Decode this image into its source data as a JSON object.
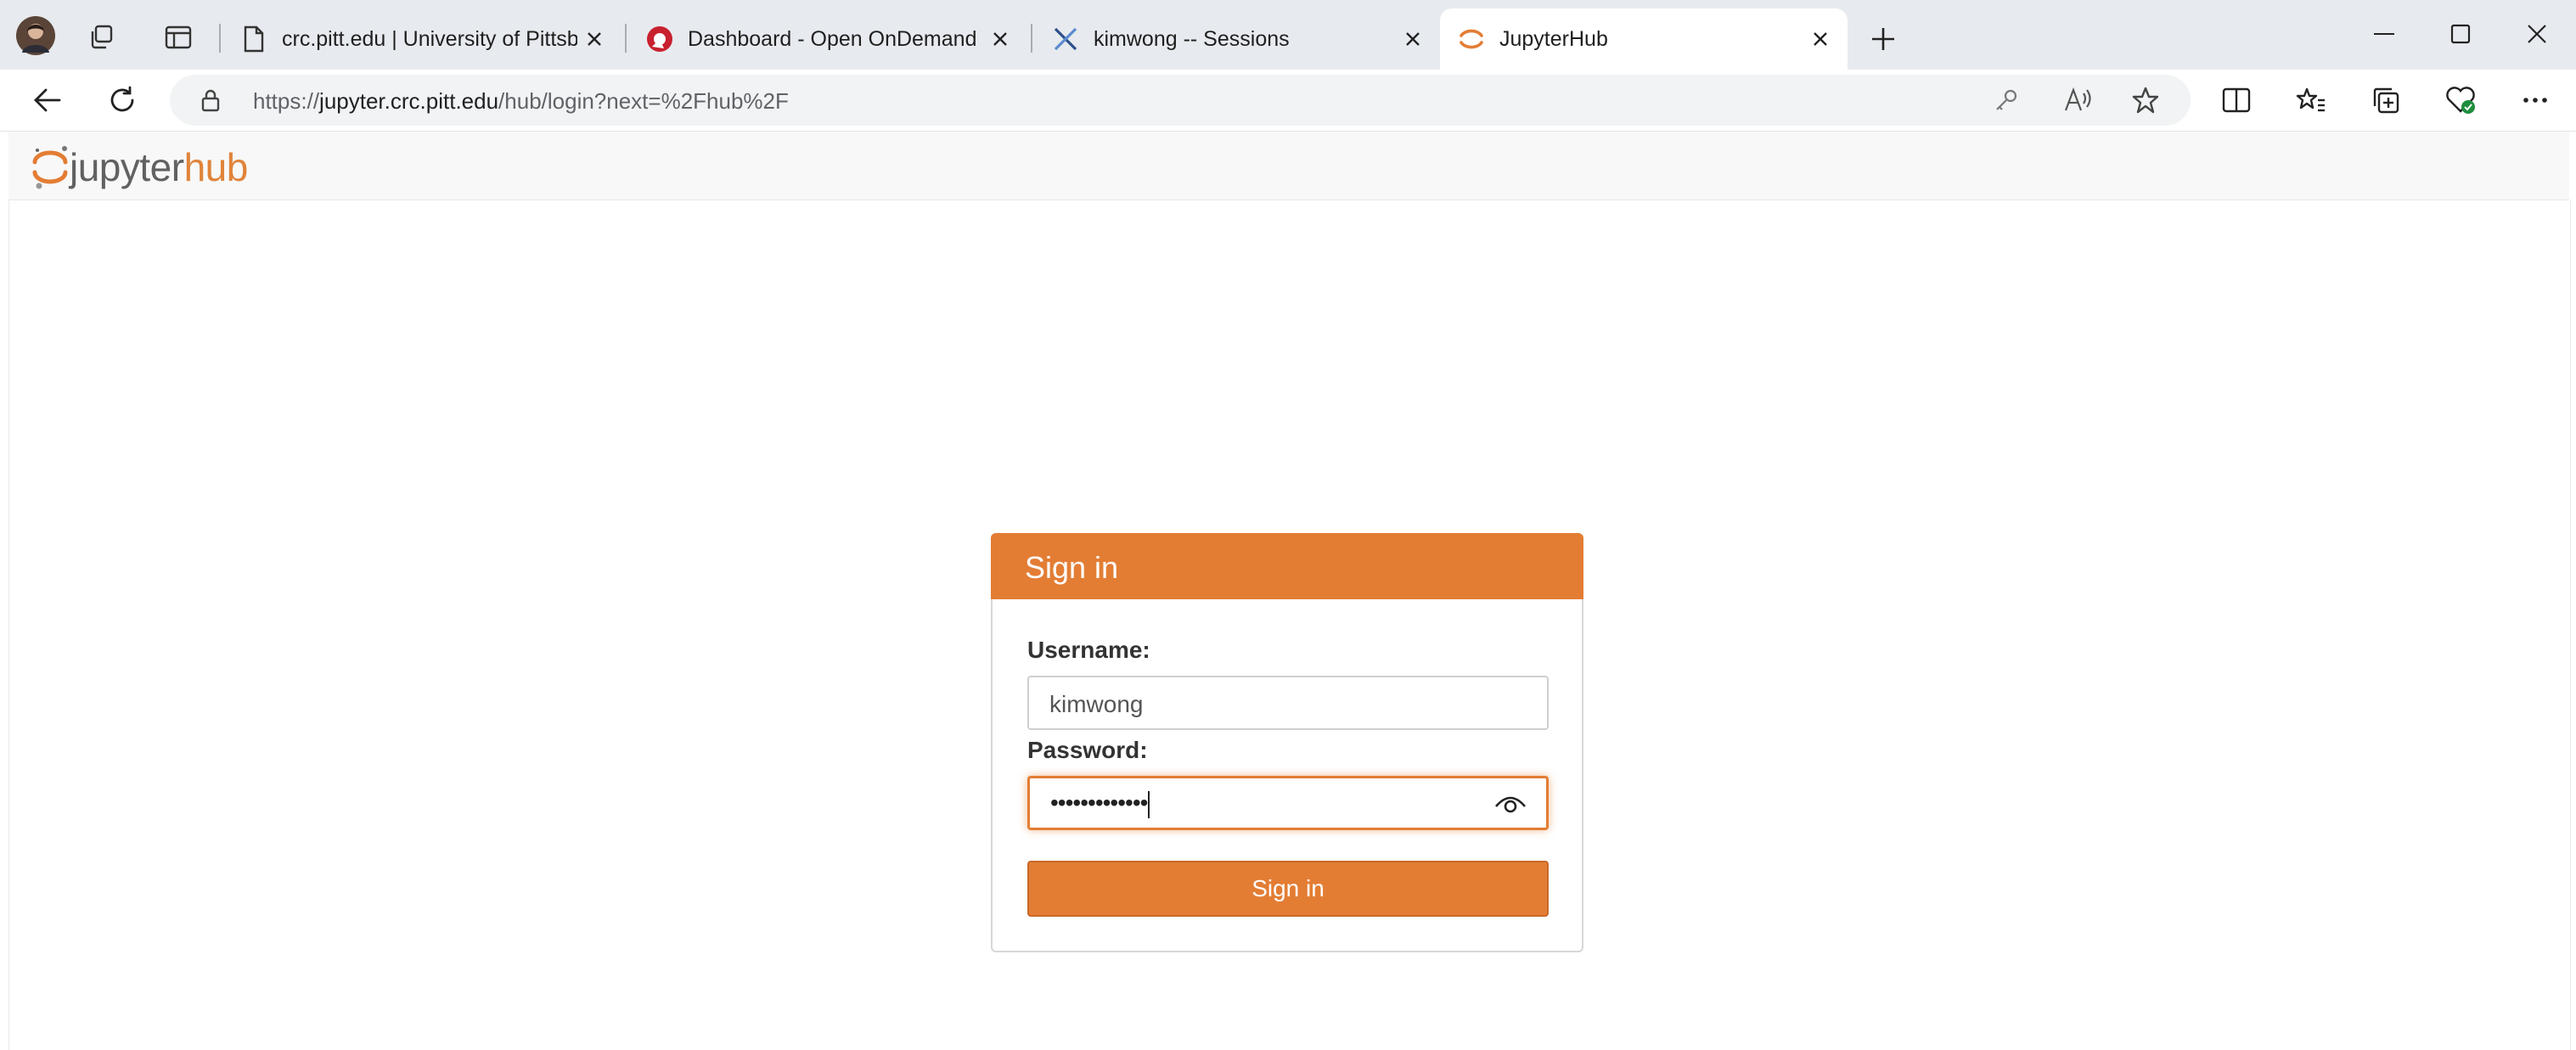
{
  "browser": {
    "tabs": [
      {
        "title": "crc.pitt.edu | University of Pittsbur",
        "favicon": "page-icon"
      },
      {
        "title": "Dashboard - Open OnDemand",
        "favicon": "open-ondemand-icon"
      },
      {
        "title": "kimwong -- Sessions",
        "favicon": "xdmod-icon"
      },
      {
        "title": "JupyterHub",
        "favicon": "jupyter-icon",
        "active": true
      }
    ],
    "address": {
      "scheme": "https://",
      "host": "jupyter.crc.pitt.edu",
      "path": "/hub/login?next=%2Fhub%2F"
    }
  },
  "header": {
    "logo_text_a": "jupyter",
    "logo_text_b": "hub"
  },
  "login": {
    "title": "Sign in",
    "username_label": "Username:",
    "username_value": "kimwong",
    "password_label": "Password:",
    "password_mask": "•••••••••••••",
    "submit_label": "Sign in"
  },
  "colors": {
    "accent": "#e37d34",
    "tabbar": "#e7eaee"
  }
}
